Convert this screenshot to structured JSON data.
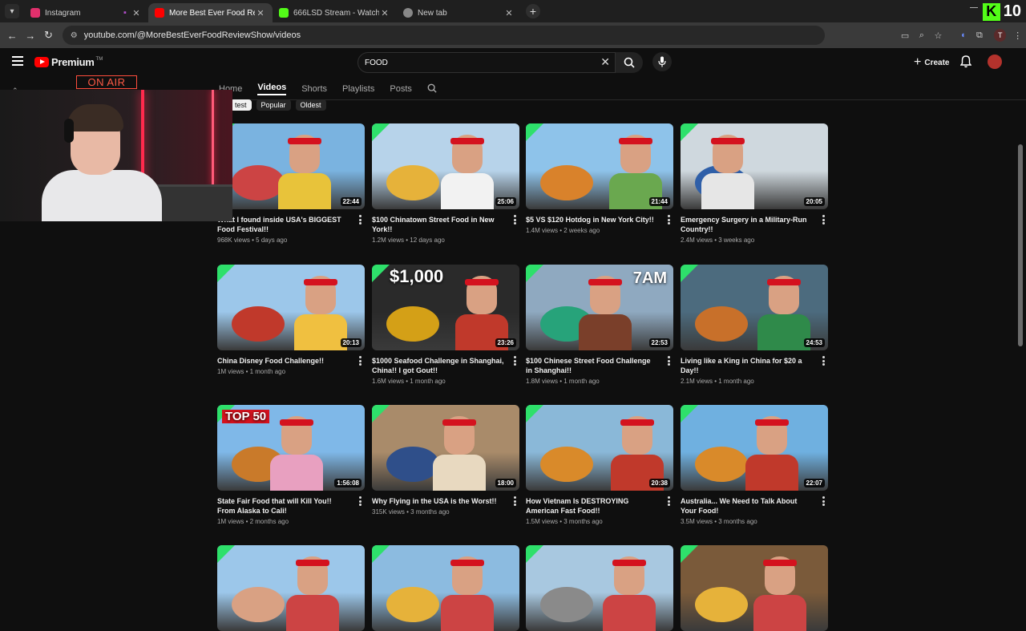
{
  "browser": {
    "tabs": [
      {
        "title": "Instagram",
        "color": "#e1306c",
        "active": false
      },
      {
        "title": "More Best Ever Food Review Sh",
        "color": "#ff0000",
        "active": true
      },
      {
        "title": "666LSD Stream - Watch Live o",
        "color": "#53fc18",
        "active": false
      },
      {
        "title": "New tab",
        "color": "#888888",
        "active": false
      }
    ],
    "url": "youtube.com/@MoreBestEverFoodReviewShow/videos",
    "profile_initial": "T",
    "kick_viewers": "10"
  },
  "youtube": {
    "logo_text": "Premium",
    "logo_tm": "TM",
    "search_value": "FOOD",
    "create_label": "Create",
    "channel_tabs": [
      "Home",
      "Videos",
      "Shorts",
      "Playlists",
      "Posts"
    ],
    "active_tab": "Videos",
    "chips": [
      "test",
      "Popular",
      "Oldest"
    ]
  },
  "overlay": {
    "on_air": "ON AIR"
  },
  "videos": [
    {
      "title": "What I found inside USA's BIGGEST Food Festival!!",
      "meta": "968K views • 5 days ago",
      "duration": "22:44",
      "palette": [
        "#7ab3e0",
        "#c44",
        "#e8c33a"
      ]
    },
    {
      "title": "$100 Chinatown Street Food in New York!!",
      "meta": "1.2M views • 12 days ago",
      "duration": "25:06",
      "palette": [
        "#b7d3ea",
        "#e6b23a",
        "#f2f2f2"
      ]
    },
    {
      "title": "$5 VS $120 Hotdog in New York City!!",
      "meta": "1.4M views • 2 weeks ago",
      "duration": "21:44",
      "palette": [
        "#8ec3ea",
        "#d9822b",
        "#6aa84f"
      ]
    },
    {
      "title": "Emergency Surgery in a Military-Run Country!!",
      "meta": "2.4M views • 3 weeks ago",
      "duration": "20:05",
      "palette": [
        "#cfd8de",
        "#2f5fa8",
        "#e6e6e6"
      ]
    },
    {
      "title": "China Disney Food Challenge!!",
      "meta": "1M views • 1 month ago",
      "duration": "20:13",
      "palette": [
        "#9cc7ea",
        "#c0392b",
        "#f0c040"
      ]
    },
    {
      "title": "$1000 Seafood Challenge in Shanghai, China!! I got Gout!!",
      "meta": "1.6M views • 1 month ago",
      "duration": "23:26",
      "palette": [
        "#2a2a2a",
        "#d4a017",
        "#c0392b"
      ],
      "overlay": "$1,000"
    },
    {
      "title": "$100 Chinese Street Food Challenge in Shanghai!!",
      "meta": "1.8M views • 1 month ago",
      "duration": "22:53",
      "palette": [
        "#8fa9c0",
        "#27a37a",
        "#7a3f2a"
      ],
      "overlay": "7AM"
    },
    {
      "title": "Living like a King in China for $20 a Day!!",
      "meta": "2.1M views • 1 month ago",
      "duration": "24:53",
      "palette": [
        "#4c6b7e",
        "#c8702a",
        "#2f8a4a"
      ]
    },
    {
      "title": "State Fair Food that will Kill You!! From Alaska to Cali!",
      "meta": "1M views • 2 months ago",
      "duration": "1:56:08",
      "palette": [
        "#7fb8e8",
        "#c97a2a",
        "#e8a0c0"
      ],
      "overlay": "TOP 50"
    },
    {
      "title": "Why Flying in the USA is the Worst!!",
      "meta": "315K views • 3 months ago",
      "duration": "18:00",
      "palette": [
        "#a98b6a",
        "#2f4f8a",
        "#e8d9c0"
      ]
    },
    {
      "title": "How Vietnam Is DESTROYING American Fast Food!!",
      "meta": "1.5M views • 3 months ago",
      "duration": "20:38",
      "palette": [
        "#8ab8d8",
        "#d98a2a",
        "#c0392b"
      ]
    },
    {
      "title": "Australia... We Need to Talk About Your Food!",
      "meta": "3.5M views • 3 months ago",
      "duration": "22:07",
      "palette": [
        "#6fb0e0",
        "#d98a2a",
        "#c0392b"
      ]
    },
    {
      "title": "",
      "meta": "",
      "duration": "",
      "palette": [
        "#9cc7ea",
        "#d9a183",
        "#c44"
      ]
    },
    {
      "title": "",
      "meta": "",
      "duration": "",
      "palette": [
        "#8cbbe0",
        "#e6b23a",
        "#c44"
      ]
    },
    {
      "title": "",
      "meta": "",
      "duration": "",
      "palette": [
        "#a8c8e0",
        "#8a8a8a",
        "#c44"
      ]
    },
    {
      "title": "",
      "meta": "",
      "duration": "",
      "palette": [
        "#7a5a3a",
        "#e6b23a",
        "#c44"
      ]
    }
  ]
}
